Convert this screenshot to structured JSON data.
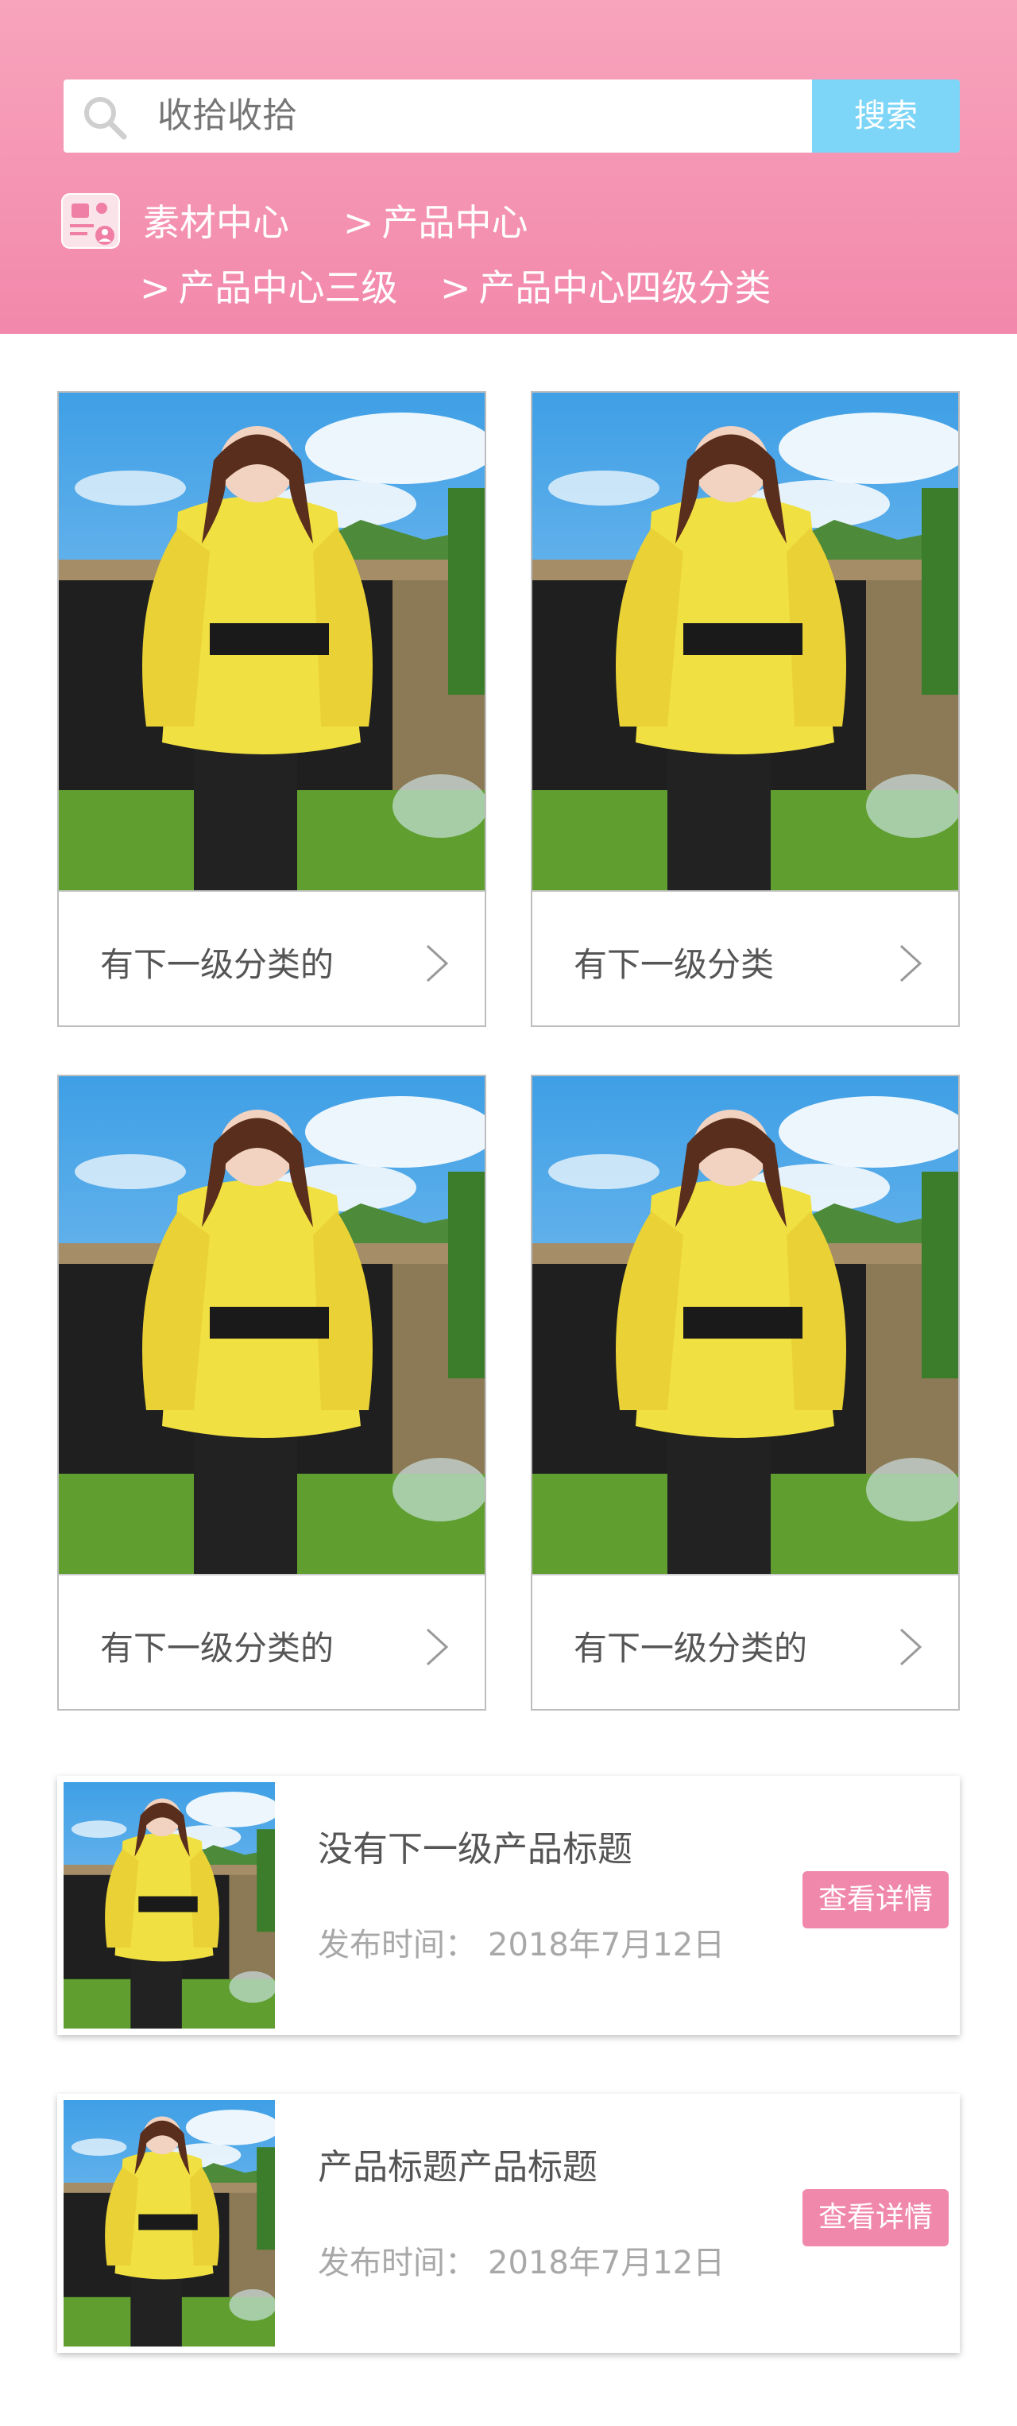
{
  "search": {
    "placeholder": "收拾收拾",
    "button_label": "搜索"
  },
  "breadcrumb": {
    "items": [
      {
        "label": "素材中心",
        "sep": ""
      },
      {
        "label": "产品中心",
        "sep": ">"
      },
      {
        "label": "产品中心三级",
        "sep": ">"
      },
      {
        "label": "产品中心四级分类",
        "sep": ">"
      }
    ]
  },
  "categories": [
    {
      "label": "有下一级分类的"
    },
    {
      "label": "有下一级分类"
    },
    {
      "label": "有下一级分类的"
    },
    {
      "label": "有下一级分类的"
    }
  ],
  "products": [
    {
      "title": "没有下一级产品标题",
      "date_label": "发布时间：",
      "date": "2018年7月12日",
      "button": "查看详情"
    },
    {
      "title": "产品标题产品标题",
      "date_label": "发布时间：",
      "date": "2018年7月12日",
      "button": "查看详情"
    }
  ],
  "colors": {
    "header_top": "#f8a4bd",
    "header_bottom": "#f288ab",
    "search_button": "#7dd5f7",
    "detail_button": "#f088ab"
  },
  "icons": [
    "search-icon",
    "breadcrumb-app-icon",
    "chevron-right-icon"
  ]
}
